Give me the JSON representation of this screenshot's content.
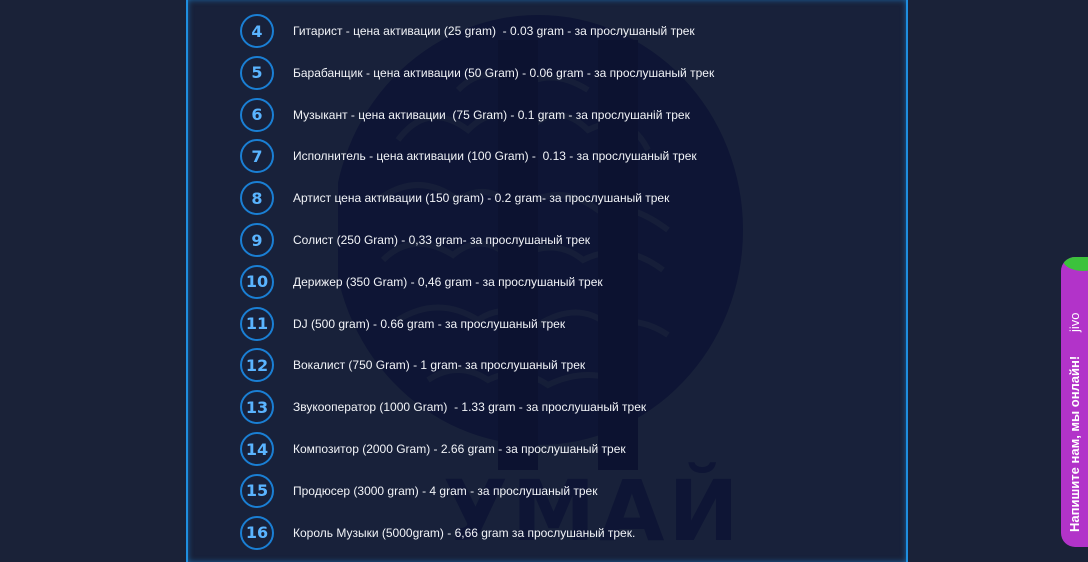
{
  "levels": [
    {
      "num": "4",
      "text": "Гитарист - цена активации (25 gram)  - 0.03 gram - за прослушаный трек"
    },
    {
      "num": "5",
      "text": "Барабанщик - цена активации (50 Gram) - 0.06 gram - за прослушаный трек"
    },
    {
      "num": "6",
      "text": "Музыкант - цена активации  (75 Gram) - 0.1 gram - за прослушаній трек"
    },
    {
      "num": "7",
      "text": "Исполнитель - цена активации (100 Gram) -  0.13 - за прослушаный трек"
    },
    {
      "num": "8",
      "text": "Артист цена активации (150 gram) - 0.2 gram- за прослушаный трек"
    },
    {
      "num": "9",
      "text": "Солист (250 Gram) - 0,33 gram- за прослушаный трек"
    },
    {
      "num": "10",
      "text": "Дерижер (350 Gram) - 0,46 gram - за прослушаный трек"
    },
    {
      "num": "11",
      "text": "DJ (500 gram) - 0.66 gram - за прослушаный трек"
    },
    {
      "num": "12",
      "text": "Вокалист (750 Gram) - 1 gram- за прослушаный трек"
    },
    {
      "num": "13",
      "text": "Звукооператор (1000 Gram)  - 1.33 gram - за прослушаный трек"
    },
    {
      "num": "14",
      "text": "Композитор (2000 Gram) - 2.66 gram - за прослушаный трек"
    },
    {
      "num": "15",
      "text": "Продюсер (3000 gram) - 4 gram - за прослушаный трек"
    },
    {
      "num": "16",
      "text": "Король Музыки (5000gram) - 6,66 gram за прослушаный трек."
    }
  ],
  "watermark_text": "УМАЙ",
  "chat": {
    "brand": "jivo",
    "label": "Напишите нам, мы онлайн!"
  }
}
